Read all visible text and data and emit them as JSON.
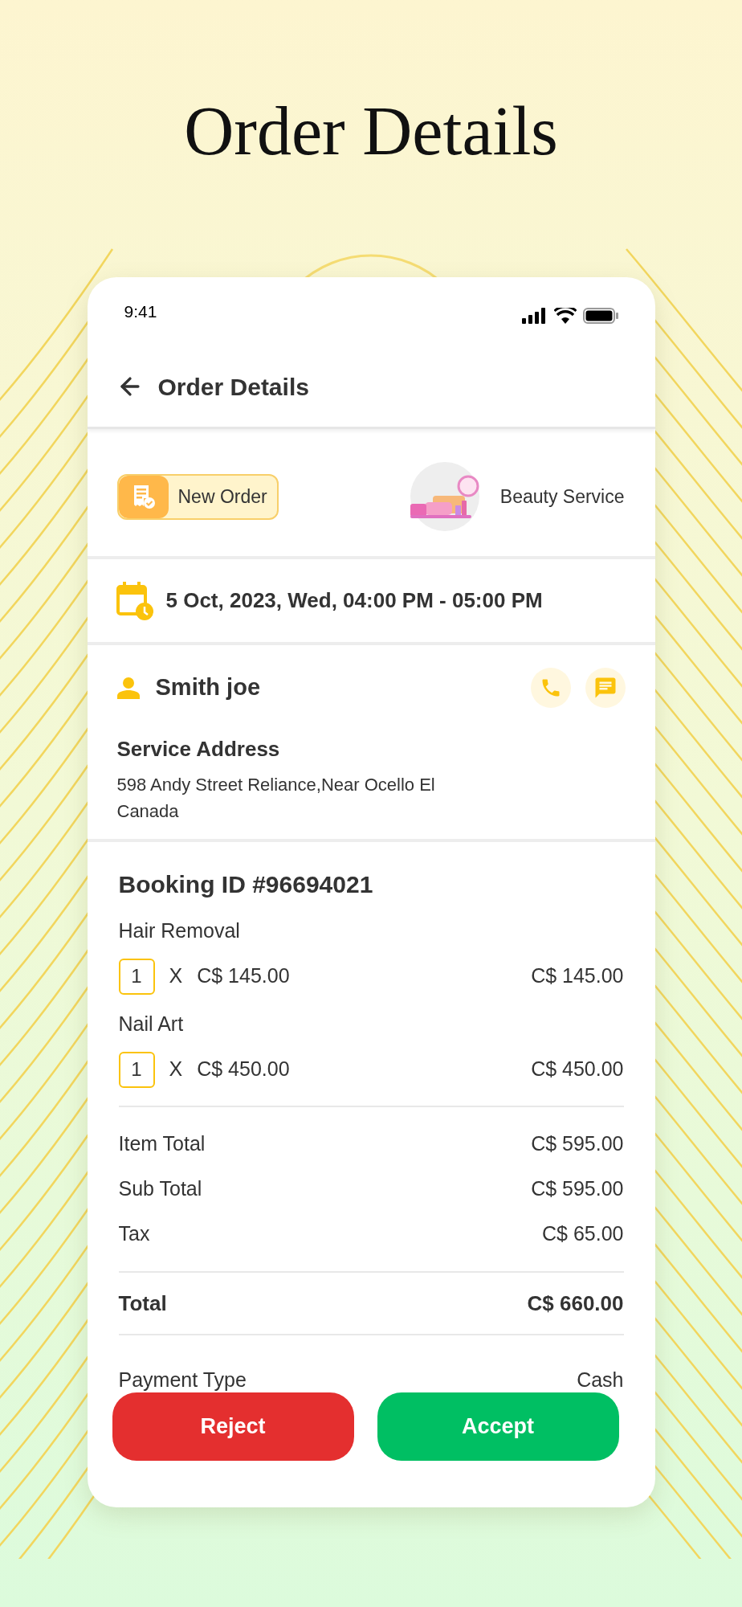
{
  "headline": "Order Details",
  "status_bar": {
    "time": "9:41"
  },
  "header": {
    "title": "Order Details"
  },
  "order": {
    "status_badge": "New Order",
    "category": "Beauty Service"
  },
  "schedule": "5 Oct, 2023, Wed, 04:00 PM - 05:00 PM",
  "customer": {
    "name": "Smith joe",
    "address_label": "Service Address",
    "address_lines": [
      "598 Andy Street Reliance,Near Ocello El",
      "Canada"
    ]
  },
  "booking": {
    "title": "Booking ID #96694021",
    "items": [
      {
        "name": "Hair Removal",
        "quantity": "1",
        "multiplier": "X",
        "unit_price": "C$ 145.00",
        "amount": "C$ 145.00"
      },
      {
        "name": "Nail Art",
        "quantity": "1",
        "multiplier": "X",
        "unit_price": "C$ 450.00",
        "amount": "C$ 450.00"
      }
    ]
  },
  "summary": [
    {
      "label": "Item Total",
      "value": "C$ 595.00"
    },
    {
      "label": "Sub Total",
      "value": "C$ 595.00"
    },
    {
      "label": "Tax",
      "value": "C$ 65.00"
    }
  ],
  "total": {
    "label": "Total",
    "value": "C$ 660.00"
  },
  "payment": [
    {
      "label": "Payment Type",
      "value": "Cash"
    }
  ],
  "actions": [
    {
      "label": "Reject",
      "kind": "reject"
    },
    {
      "label": "Accept",
      "kind": "accept"
    }
  ]
}
